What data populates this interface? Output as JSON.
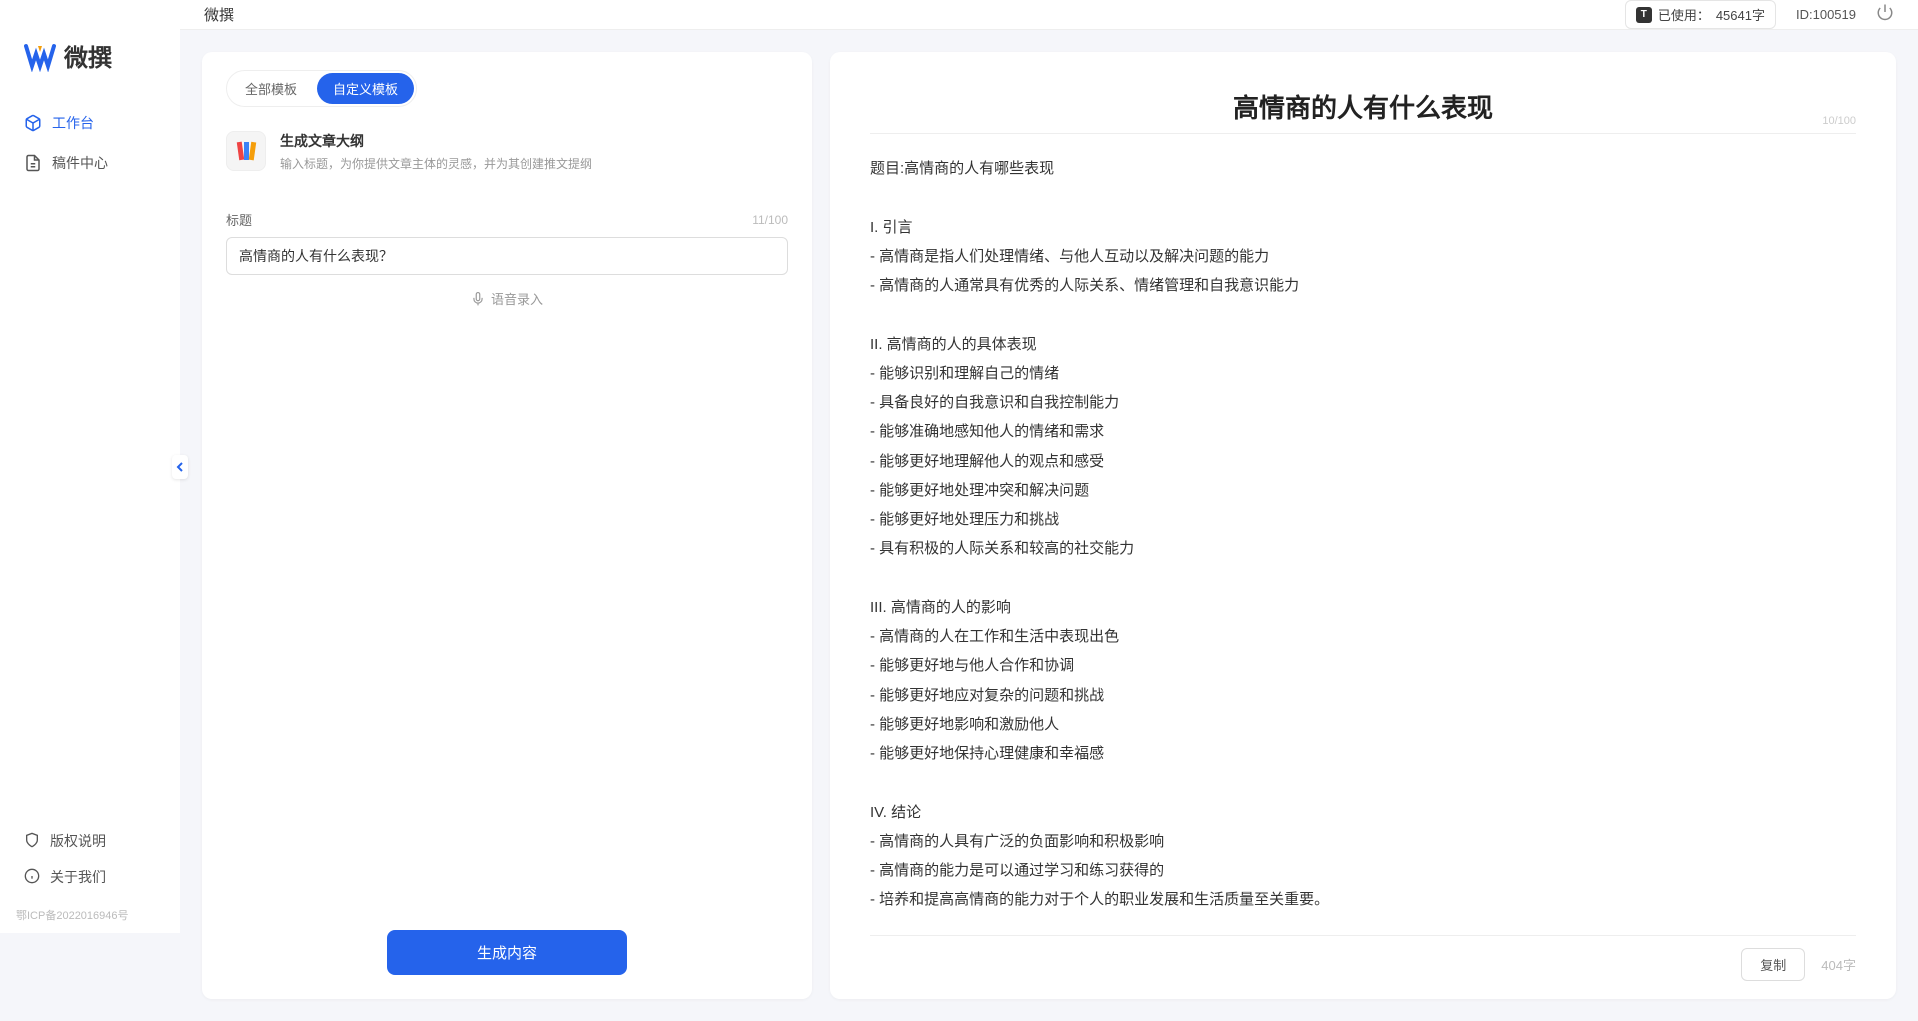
{
  "app": {
    "name": "微撰"
  },
  "sidebar": {
    "nav": [
      {
        "label": "工作台",
        "active": true
      },
      {
        "label": "稿件中心",
        "active": false
      }
    ],
    "bottom": [
      {
        "label": "版权说明"
      },
      {
        "label": "关于我们"
      }
    ],
    "icp": "鄂ICP备2022016946号"
  },
  "topbar": {
    "title": "微撰",
    "usageLabel": "已使用：",
    "usageValue": "45641字",
    "userIdLabel": "ID:",
    "userId": "100519"
  },
  "leftPanel": {
    "tabs": [
      {
        "label": "全部模板",
        "active": false
      },
      {
        "label": "自定义模板",
        "active": true
      }
    ],
    "template": {
      "title": "生成文章大纲",
      "desc": "输入标题，为你提供文章主体的灵感，并为其创建推文提纲"
    },
    "form": {
      "label": "标题",
      "counter": "11/100",
      "value": "高情商的人有什么表现？"
    },
    "voice": "语音录入",
    "generateBtn": "生成内容"
  },
  "rightPanel": {
    "title": "高情商的人有什么表现",
    "titleCounter": "10/100",
    "body": "题目:高情商的人有哪些表现\n\nI. 引言\n- 高情商是指人们处理情绪、与他人互动以及解决问题的能力\n- 高情商的人通常具有优秀的人际关系、情绪管理和自我意识能力\n\nII. 高情商的人的具体表现\n- 能够识别和理解自己的情绪\n- 具备良好的自我意识和自我控制能力\n- 能够准确地感知他人的情绪和需求\n- 能够更好地理解他人的观点和感受\n- 能够更好地处理冲突和解决问题\n- 能够更好地处理压力和挑战\n- 具有积极的人际关系和较高的社交能力\n\nIII. 高情商的人的影响\n- 高情商的人在工作和生活中表现出色\n- 能够更好地与他人合作和协调\n- 能够更好地应对复杂的问题和挑战\n- 能够更好地影响和激励他人\n- 能够更好地保持心理健康和幸福感\n\nIV. 结论\n- 高情商的人具有广泛的负面影响和积极影响\n- 高情商的能力是可以通过学习和练习获得的\n- 培养和提高高情商的能力对于个人的职业发展和生活质量至关重要。",
    "copyBtn": "复制",
    "wordCount": "404字"
  }
}
